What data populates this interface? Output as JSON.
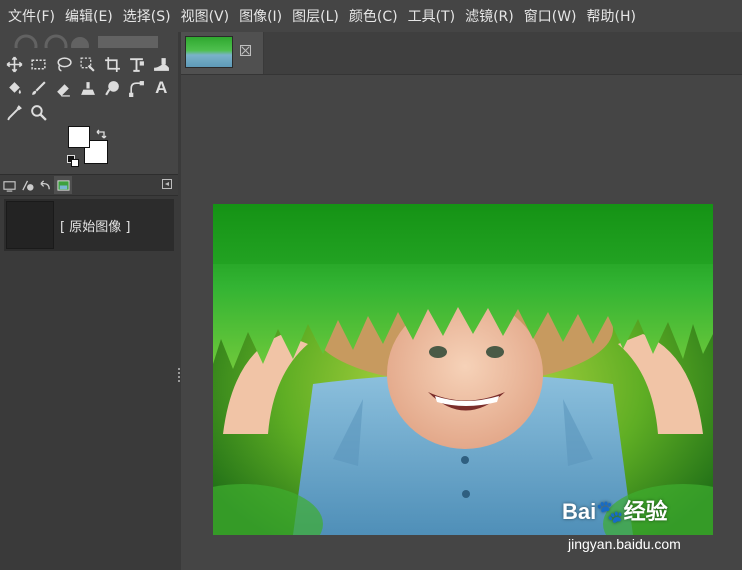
{
  "menubar": {
    "items": [
      "文件(F)",
      "编辑(E)",
      "选择(S)",
      "视图(V)",
      "图像(I)",
      "图层(L)",
      "颜色(C)",
      "工具(T)",
      "滤镜(R)",
      "窗口(W)",
      "帮助(H)"
    ]
  },
  "toolbox": {
    "rows": [
      [
        "move-tool",
        "rect-select-tool",
        "free-select-tool",
        "fuzzy-select-tool",
        "crop-tool",
        "transform-tool",
        "warp-tool"
      ],
      [
        "bucket-fill-tool",
        "paintbrush-tool",
        "eraser-tool",
        "clone-tool",
        "smudge-tool",
        "paths-tool",
        "text-tool"
      ],
      [
        "color-picker-tool",
        "zoom-tool"
      ]
    ],
    "text_tool_glyph": "A",
    "fg_color": "#ffffff",
    "bg_color": "#ffffff"
  },
  "dock": {
    "tabs": [
      "tool-options-icon",
      "device-status-icon",
      "undo-history-icon",
      "images-icon"
    ],
    "active_tab": 3
  },
  "history": {
    "items": [
      {
        "label": "[ 原始图像 ]"
      }
    ]
  },
  "image_tabs": [
    {
      "name": "image-tab-thumbnail"
    }
  ],
  "watermark": {
    "logo": "Bai🐾经验",
    "url": "jingyan.baidu.com"
  },
  "colors": {
    "ui_bg": "#454545",
    "panel_dark": "#3a3a3a",
    "menu_text": "#e6e6e6",
    "grass_green": "#2f9e2f",
    "shirt_blue": "#6aa7c9"
  }
}
